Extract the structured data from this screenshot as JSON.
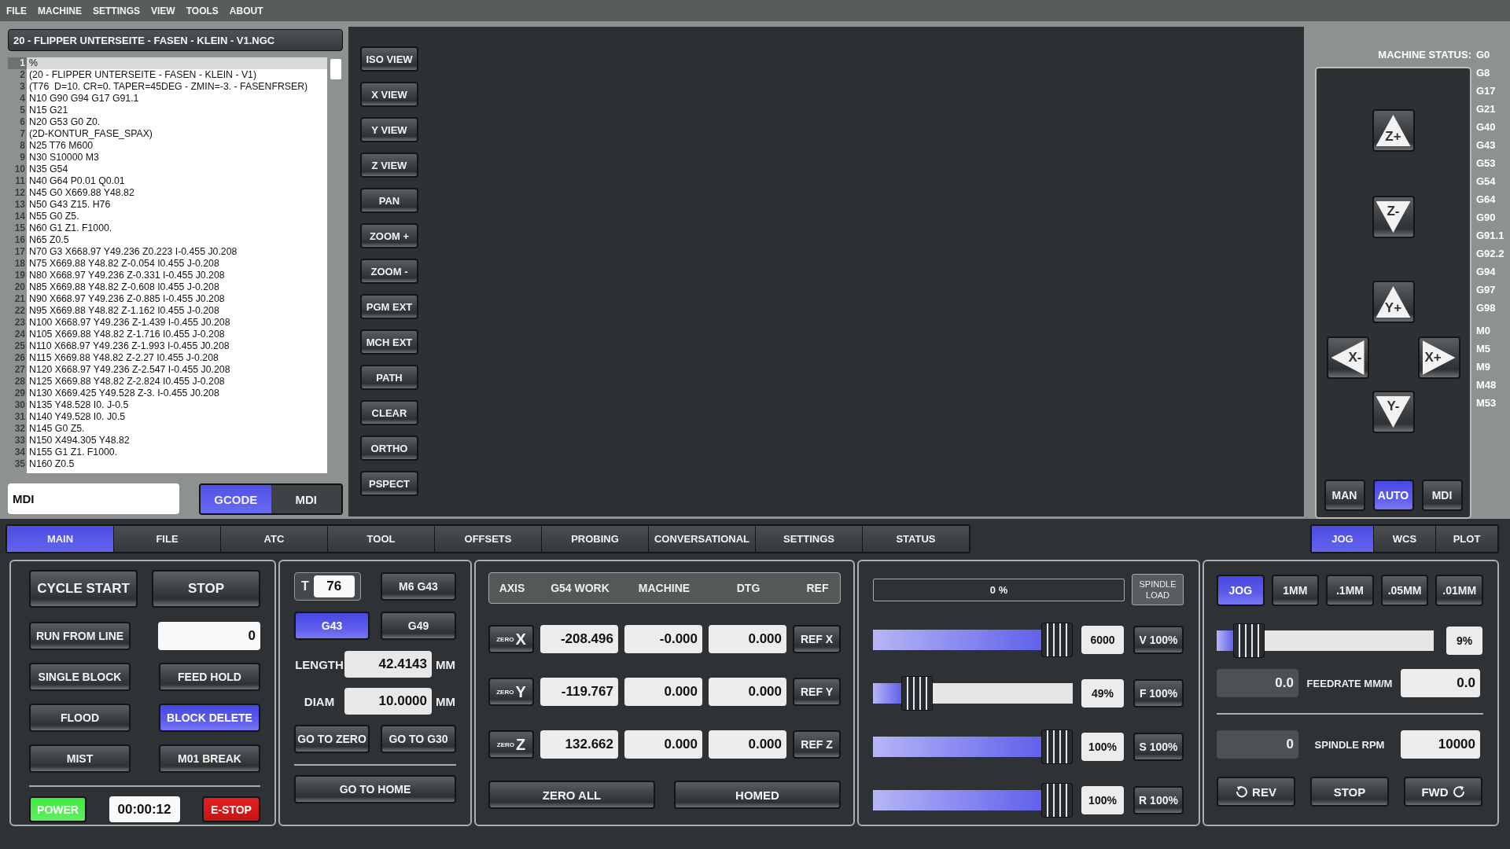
{
  "menu": [
    "FILE",
    "MACHINE",
    "SETTINGS",
    "VIEW",
    "TOOLS",
    "ABOUT"
  ],
  "file_title": "20 - FLIPPER UNTERSEITE - FASEN - KLEIN - V1.NGC",
  "editor": {
    "lines": [
      {
        "number": "1",
        "text": "%",
        "selected": true
      },
      {
        "number": "2",
        "text": "(20 - FLIPPER UNTERSEITE - FASEN - KLEIN - V1)",
        "selected": false
      },
      {
        "number": "3",
        "text": "(T76  D=10. CR=0. TAPER=45DEG - ZMIN=-3. - FASENFRSER)",
        "selected": false
      },
      {
        "number": "4",
        "text": "N10 G90 G94 G17 G91.1",
        "selected": false
      },
      {
        "number": "5",
        "text": "N15 G21",
        "selected": false
      },
      {
        "number": "6",
        "text": "N20 G53 G0 Z0.",
        "selected": false
      },
      {
        "number": "7",
        "text": "(2D-KONTUR_FASE_SPAX)",
        "selected": false
      },
      {
        "number": "8",
        "text": "N25 T76 M600",
        "selected": false
      },
      {
        "number": "9",
        "text": "N30 S10000 M3",
        "selected": false
      },
      {
        "number": "10",
        "text": "N35 G54",
        "selected": false
      },
      {
        "number": "11",
        "text": "N40 G64 P0.01 Q0.01",
        "selected": false
      },
      {
        "number": "12",
        "text": "N45 G0 X669.88 Y48.82",
        "selected": false
      },
      {
        "number": "13",
        "text": "N50 G43 Z15. H76",
        "selected": false
      },
      {
        "number": "14",
        "text": "N55 G0 Z5.",
        "selected": false
      },
      {
        "number": "15",
        "text": "N60 G1 Z1. F1000.",
        "selected": false
      },
      {
        "number": "16",
        "text": "N65 Z0.5",
        "selected": false
      },
      {
        "number": "17",
        "text": "N70 G3 X668.97 Y49.236 Z0.223 I-0.455 J0.208",
        "selected": false
      },
      {
        "number": "18",
        "text": "N75 X669.88 Y48.82 Z-0.054 I0.455 J-0.208",
        "selected": false
      },
      {
        "number": "19",
        "text": "N80 X668.97 Y49.236 Z-0.331 I-0.455 J0.208",
        "selected": false
      },
      {
        "number": "20",
        "text": "N85 X669.88 Y48.82 Z-0.608 I0.455 J-0.208",
        "selected": false
      },
      {
        "number": "21",
        "text": "N90 X668.97 Y49.236 Z-0.885 I-0.455 J0.208",
        "selected": false
      },
      {
        "number": "22",
        "text": "N95 X669.88 Y48.82 Z-1.162 I0.455 J-0.208",
        "selected": false
      },
      {
        "number": "23",
        "text": "N100 X668.97 Y49.236 Z-1.439 I-0.455 J0.208",
        "selected": false
      },
      {
        "number": "24",
        "text": "N105 X669.88 Y48.82 Z-1.716 I0.455 J-0.208",
        "selected": false
      },
      {
        "number": "25",
        "text": "N110 X668.97 Y49.236 Z-1.993 I-0.455 J0.208",
        "selected": false
      },
      {
        "number": "26",
        "text": "N115 X669.88 Y48.82 Z-2.27 I0.455 J-0.208",
        "selected": false
      },
      {
        "number": "27",
        "text": "N120 X668.97 Y49.236 Z-2.547 I-0.455 J0.208",
        "selected": false
      },
      {
        "number": "28",
        "text": "N125 X669.88 Y48.82 Z-2.824 I0.455 J-0.208",
        "selected": false
      },
      {
        "number": "29",
        "text": "N130 X669.425 Y49.528 Z-3. I-0.455 J0.208",
        "selected": false
      },
      {
        "number": "30",
        "text": "N135 Y48.528 I0. J-0.5",
        "selected": false
      },
      {
        "number": "31",
        "text": "N140 Y49.528 I0. J0.5",
        "selected": false
      },
      {
        "number": "32",
        "text": "N145 G0 Z5.",
        "selected": false
      },
      {
        "number": "33",
        "text": "N150 X494.305 Y48.82",
        "selected": false
      },
      {
        "number": "34",
        "text": "N155 G1 Z1. F1000.",
        "selected": false
      },
      {
        "number": "35",
        "text": "N160 Z0.5",
        "selected": false
      }
    ]
  },
  "mdi_field": {
    "value": "MDI"
  },
  "editor_modes": [
    {
      "label": "GCODE",
      "selected": true
    },
    {
      "label": "MDI",
      "selected": false
    }
  ],
  "view_buttons": [
    "ISO VIEW",
    "X VIEW",
    "Y VIEW",
    "Z VIEW",
    "PAN",
    "ZOOM +",
    "ZOOM -",
    "PGM EXT",
    "MCH EXT",
    "PATH",
    "CLEAR",
    "ORTHO",
    "PSPECT"
  ],
  "machine_status": {
    "label": "MACHINE STATUS:",
    "g_codes": [
      "G0",
      "G8",
      "G17",
      "G21",
      "G40",
      "G43",
      "G53",
      "G54",
      "G64",
      "G90",
      "G91.1",
      "G92.2",
      "G94",
      "G97",
      "G98"
    ],
    "m_codes": [
      "M0",
      "M5",
      "M9",
      "M48",
      "M53"
    ]
  },
  "jog_buttons": [
    {
      "label": "Z+",
      "kind": "up"
    },
    {
      "label": "Z-",
      "kind": "down"
    },
    {
      "label": "Y+",
      "kind": "up"
    },
    {
      "label": "X-",
      "kind": "left"
    },
    {
      "label": "X+",
      "kind": "right"
    },
    {
      "label": "Y-",
      "kind": "down"
    }
  ],
  "mode_buttons": [
    {
      "label": "MAN",
      "selected": false
    },
    {
      "label": "AUTO",
      "selected": true
    },
    {
      "label": "MDI",
      "selected": false
    }
  ],
  "main_tabs": [
    {
      "label": "MAIN",
      "selected": true
    },
    {
      "label": "FILE",
      "selected": false
    },
    {
      "label": "ATC",
      "selected": false
    },
    {
      "label": "TOOL",
      "selected": false
    },
    {
      "label": "OFFSETS",
      "selected": false
    },
    {
      "label": "PROBING",
      "selected": false
    },
    {
      "label": "CONVERSATIONAL",
      "selected": false
    },
    {
      "label": "SETTINGS",
      "selected": false
    },
    {
      "label": "STATUS",
      "selected": false
    }
  ],
  "side_tabs": [
    {
      "label": "JOG",
      "selected": true
    },
    {
      "label": "WCS",
      "selected": false
    },
    {
      "label": "PLOT",
      "selected": false
    }
  ],
  "program_panel": {
    "rows": [
      [
        {
          "kind": "large",
          "label": "CYCLE START",
          "selected": false
        },
        {
          "kind": "large",
          "label": "STOP",
          "selected": false
        }
      ],
      [
        {
          "kind": "button",
          "label": "RUN FROM LINE",
          "selected": false
        },
        {
          "kind": "field",
          "value": "0"
        }
      ],
      [
        {
          "kind": "button",
          "label": "SINGLE BLOCK",
          "selected": false
        },
        {
          "kind": "button",
          "label": "FEED HOLD",
          "selected": false
        }
      ],
      [
        {
          "kind": "button",
          "label": "FLOOD",
          "selected": false
        },
        {
          "kind": "button",
          "label": "BLOCK DELETE",
          "selected": true
        }
      ],
      [
        {
          "kind": "button",
          "label": "MIST",
          "selected": false
        },
        {
          "kind": "button",
          "label": "M01 BREAK",
          "selected": false
        }
      ]
    ],
    "power": {
      "label": "POWER",
      "on": true
    },
    "timer": "00:00:12",
    "estop": {
      "label": "E-STOP"
    }
  },
  "tool_panel": {
    "tool_label": "T",
    "tool_number": "76",
    "change_button": "M6 G43",
    "offset_buttons": [
      {
        "label": "G43",
        "selected": true
      },
      {
        "label": "G49",
        "selected": false
      }
    ],
    "measures": [
      {
        "label": "LENGTH",
        "value": "42.4143",
        "unit": "MM"
      },
      {
        "label": "DIAM",
        "value": "10.0000",
        "unit": "MM"
      }
    ],
    "goto_buttons": [
      "GO TO ZERO",
      "GO TO G30"
    ],
    "home_button": "GO TO HOME"
  },
  "dro": {
    "columns": [
      "AXIS",
      "G54 WORK",
      "MACHINE",
      "DTG",
      "REF"
    ],
    "rows": [
      {
        "zero_label": "ZERO",
        "axis": "X",
        "work": "-208.496",
        "machine": "-0.000",
        "dtg": "0.000",
        "ref_button": "REF X"
      },
      {
        "zero_label": "ZERO",
        "axis": "Y",
        "work": "-119.767",
        "machine": "0.000",
        "dtg": "0.000",
        "ref_button": "REF Y"
      },
      {
        "zero_label": "ZERO",
        "axis": "Z",
        "work": "132.662",
        "machine": "0.000",
        "dtg": "0.000",
        "ref_button": "REF Z"
      }
    ],
    "buttons": [
      "ZERO ALL",
      "HOMED"
    ]
  },
  "overrides": {
    "spindle_load": {
      "reading": "0 %",
      "level": 0,
      "button": "SPINDLE LOAD"
    },
    "sliders": [
      {
        "level": 1,
        "reading": "6000",
        "button": "V 100%"
      },
      {
        "level": 0.17,
        "reading": "49%",
        "button": "F 100%"
      },
      {
        "level": 1,
        "reading": "100%",
        "button": "S 100%"
      },
      {
        "level": 1,
        "reading": "100%",
        "button": "R 100%"
      }
    ]
  },
  "jog_panel": {
    "increments": [
      {
        "label": "JOG",
        "selected": true
      },
      {
        "label": "1MM",
        "selected": false
      },
      {
        "label": ".1MM",
        "selected": false
      },
      {
        "label": ".05MM",
        "selected": false
      },
      {
        "label": ".01MM",
        "selected": false
      }
    ],
    "jog_rate": {
      "level": 0.09,
      "reading": "9%"
    },
    "feedrate": {
      "actual": "0.0",
      "label": "FEEDRATE MM/M",
      "commanded": "0.0"
    },
    "spindle": {
      "actual": "0",
      "label": "SPINDLE RPM",
      "commanded": "10000"
    },
    "spindle_buttons": [
      {
        "kind": "rev",
        "label": "REV"
      },
      {
        "kind": "stop",
        "label": "STOP"
      },
      {
        "kind": "fwd",
        "label": "FWD"
      }
    ]
  }
}
